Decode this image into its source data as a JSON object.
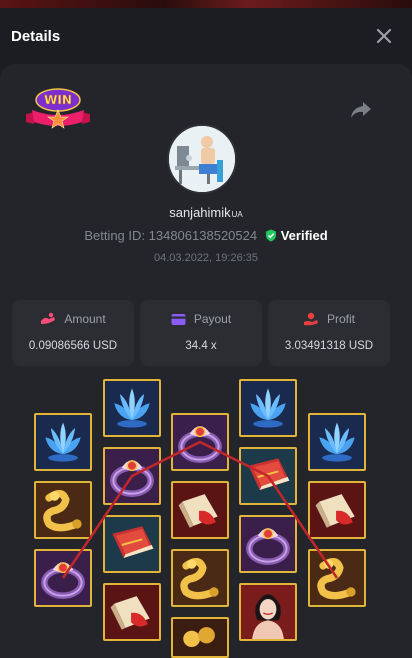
{
  "header": {
    "title": "Details"
  },
  "player": {
    "username": "sanjahimik",
    "country": "UA",
    "betting_id_label": "Betting ID:",
    "betting_id": "134806138520524",
    "verified_label": "Verified",
    "datetime": "04.03.2022, 19:26:35"
  },
  "stats": {
    "amount": {
      "label": "Amount",
      "value": "0.09086566 USD"
    },
    "payout": {
      "label": "Payout",
      "value": "34.4 x"
    },
    "profit": {
      "label": "Profit",
      "value": "3.03491318 USD"
    }
  },
  "badge": {
    "text": "WIN"
  },
  "colors": {
    "accent_red": "#e8403f",
    "accent_purple": "#8b5cf6",
    "verified_green": "#22c55e",
    "frame_gold": "#e2b437",
    "payline": "#c0262b"
  },
  "reels": [
    [
      "blue-lotus",
      "golden-snake",
      "purple-ring"
    ],
    [
      "blue-lotus",
      "purple-ring",
      "red-scroll-book",
      "red-scroll-book"
    ],
    [
      "purple-ring",
      "red-scroll-book",
      "golden-snake",
      "gold-coins"
    ],
    [
      "blue-lotus",
      "red-scroll-book",
      "purple-ring",
      "geisha-woman"
    ],
    [
      "blue-lotus",
      "red-scroll-book",
      "golden-snake"
    ]
  ]
}
